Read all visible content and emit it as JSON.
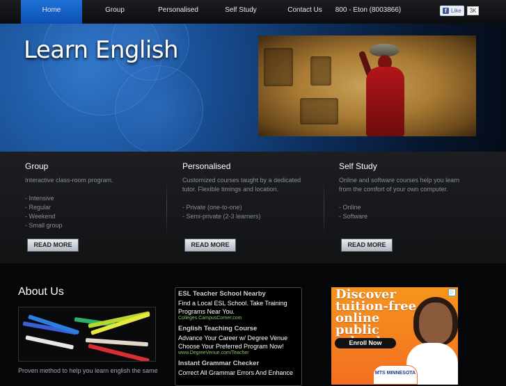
{
  "nav": {
    "items": [
      {
        "label": "Home",
        "active": true
      },
      {
        "label": "Group"
      },
      {
        "label": "Personalised"
      },
      {
        "label": "Self Study"
      },
      {
        "label": "Contact Us"
      }
    ],
    "phone": "800 - Eton (8003866)",
    "fb_like": "Like",
    "fb_count": "3K"
  },
  "hero": {
    "title": "Learn English"
  },
  "features": [
    {
      "title": "Group",
      "lines": [
        "Interactive class-room program.",
        "",
        "- Intensive",
        "- Regular",
        "- Weekend",
        "- Small group"
      ],
      "button": "READ MORE"
    },
    {
      "title": "Personalised",
      "lines": [
        "Customized courses taught by a dedicated tutor. Flexible timings and location.",
        "",
        "- Private (one-to-one)",
        "- Semi-private (2-3 learners)"
      ],
      "button": "READ MORE"
    },
    {
      "title": "Self Study",
      "lines": [
        "Online and software courses help you learn from the comfort of your own computer.",
        "",
        "- Online",
        "- Software"
      ],
      "button": "READ MORE"
    }
  ],
  "about": {
    "title": "About Us",
    "text": "Proven method to help you learn english the same"
  },
  "ads": [
    {
      "title": "ESL Teacher School Nearby",
      "desc": "Find a Local ESL School. Take Training Programs Near You.",
      "url": "Colleges.CampusCorner.com"
    },
    {
      "title": "English Teaching Course",
      "desc": "Advance Your Career w/ Degree Venue Choose Your Preferred Program Now!",
      "url": "www.DegreeVenue.com/Teacher"
    },
    {
      "title": "Instant Grammar Checker",
      "desc": "Correct All Grammar Errors And Enhance",
      "url": ""
    }
  ],
  "banner": {
    "headline": "Discover tuition-free online public school.",
    "button": "Enroll Now",
    "logo_text": "MTS MINNESOTA"
  },
  "colors": {
    "nav_active": "#1565c8",
    "banner_orange": "#f36f21",
    "ad_url_green": "#8fc36b"
  }
}
